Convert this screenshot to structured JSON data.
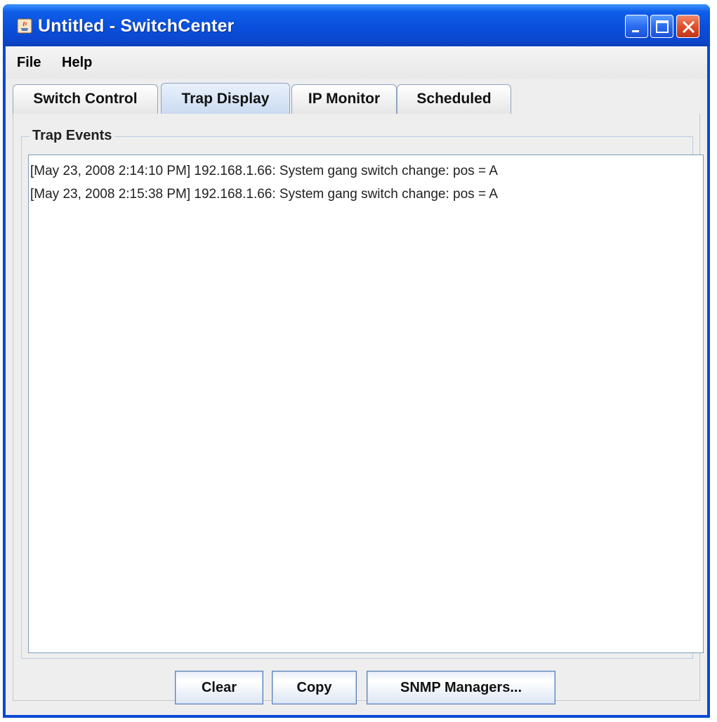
{
  "window": {
    "title": "Untitled - SwitchCenter"
  },
  "menu": {
    "items": [
      "File",
      "Help"
    ]
  },
  "tabs": [
    {
      "label": "Switch Control",
      "selected": false
    },
    {
      "label": "Trap Display",
      "selected": true
    },
    {
      "label": "IP Monitor",
      "selected": false
    },
    {
      "label": "Scheduled",
      "selected": false
    }
  ],
  "trap_events": {
    "label": "Trap Events",
    "lines": [
      "[May 23, 2008 2:14:10 PM] 192.168.1.66: System gang switch change: pos = A",
      "[May 23, 2008 2:15:38 PM] 192.168.1.66: System gang switch change: pos = A"
    ]
  },
  "buttons": {
    "clear": "Clear",
    "copy": "Copy",
    "snmp": "SNMP Managers..."
  },
  "colors": {
    "titlebar": "#0a4fdc",
    "client_bg": "#eeeeee",
    "tab_selected": "#c9daf0",
    "close_button": "#e0502a"
  }
}
